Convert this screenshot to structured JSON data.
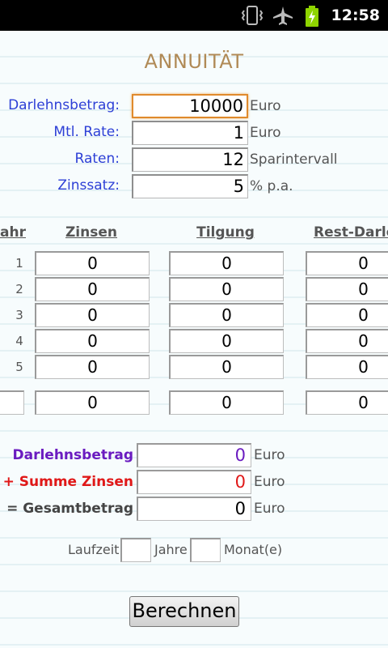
{
  "status_bar": {
    "time": "12:58"
  },
  "title": "ANNUITÄT",
  "inputs": {
    "darlehnsbetrag": {
      "label": "Darlehnsbetrag:",
      "value": "10000",
      "unit": "Euro"
    },
    "mtl_rate": {
      "label": "Mtl. Rate:",
      "value": "1",
      "unit": "Euro"
    },
    "raten": {
      "label": "Raten:",
      "value": "12",
      "unit": "Sparintervall"
    },
    "zinssatz": {
      "label": "Zinssatz:",
      "value": "5",
      "unit": "% p.a."
    }
  },
  "table": {
    "headers": {
      "jahr": "Jahr",
      "zinsen": "Zinsen",
      "tilgung": "Tilgung",
      "rest": "Rest-Darlehen"
    },
    "rows": [
      {
        "num": "1",
        "zinsen": "0",
        "tilgung": "0",
        "rest": "0"
      },
      {
        "num": "2",
        "zinsen": "0",
        "tilgung": "0",
        "rest": "0"
      },
      {
        "num": "3",
        "zinsen": "0",
        "tilgung": "0",
        "rest": "0"
      },
      {
        "num": "4",
        "zinsen": "0",
        "tilgung": "0",
        "rest": "0"
      },
      {
        "num": "5",
        "zinsen": "0",
        "tilgung": "0",
        "rest": "0"
      }
    ],
    "total_row": {
      "zinsen": "0",
      "tilgung": "0",
      "rest": "0"
    }
  },
  "summary": {
    "darlehnsbetrag": {
      "label": "Darlehnsbetrag",
      "value": "0",
      "unit": "Euro",
      "color": "#6a1bc0"
    },
    "summe_zinsen": {
      "label": "+ Summe Zinsen",
      "value": "0",
      "unit": "Euro",
      "color": "#e01818"
    },
    "gesamtbetrag": {
      "label": "= Gesamtbetrag",
      "value": "0",
      "unit": "Euro",
      "color": "#444444"
    }
  },
  "laufzeit": {
    "label": "Laufzeit",
    "jahre_label": "Jahre",
    "monate_label": "Monat(e)",
    "jahre_value": "",
    "monate_value": ""
  },
  "button": {
    "label": "Berechnen"
  },
  "colors": {
    "accent_title": "#b08a56",
    "label_blue": "#2d3fd6",
    "focus_orange": "#e08a2c"
  }
}
